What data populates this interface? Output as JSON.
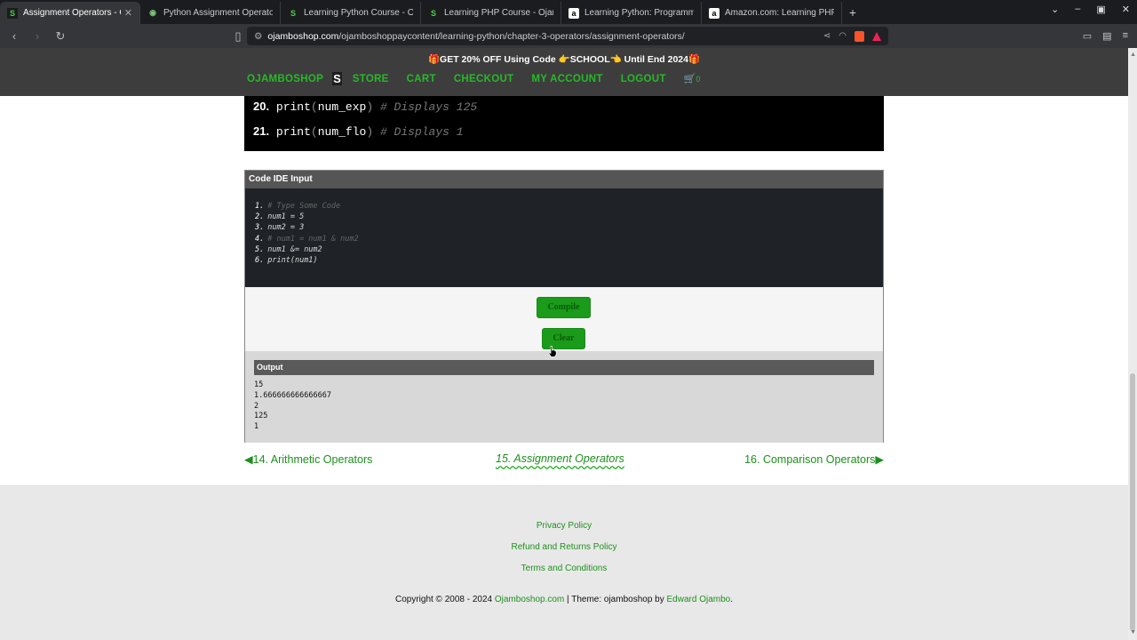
{
  "browser": {
    "tabs": [
      {
        "title": "Assignment Operators - Oj",
        "favicon": "S",
        "active": true
      },
      {
        "title": "Python Assignment Operators",
        "favicon": "P",
        "active": false
      },
      {
        "title": "Learning Python Course - Ojam",
        "favicon": "S",
        "active": false
      },
      {
        "title": "Learning PHP Course - Ojambo",
        "favicon": "S",
        "active": false
      },
      {
        "title": "Learning Python: Programmin",
        "favicon": "a",
        "active": false
      },
      {
        "title": "Amazon.com: Learning PHP: Pr",
        "favicon": "a",
        "active": false
      }
    ],
    "url_host": "ojamboshop.com",
    "url_path": "/ojamboshoppaycontent/learning-python/chapter-3-operators/assignment-operators/"
  },
  "site": {
    "promo": "🎁GET 20% OFF Using Code 👉SCHOOL👈 Until End 2024🎁",
    "brand": "OJAMBOSHOP",
    "brand_logo": "S",
    "menu": [
      "STORE",
      "CART",
      "CHECKOUT",
      "MY ACCOUNT",
      "LOGOUT"
    ],
    "cart_count": "0"
  },
  "code_snippet": [
    {
      "num": "20.",
      "code": "print",
      "arg": "num_exp",
      "comment": "# Displays 125"
    },
    {
      "num": "21.",
      "code": "print",
      "arg": "num_flo",
      "comment": "# Displays 1"
    }
  ],
  "ide": {
    "header": "Code IDE Input",
    "lines": [
      {
        "num": "1.",
        "text": "# Type Some Code",
        "type": "comment"
      },
      {
        "num": "2.",
        "text": "num1 = 5",
        "type": "code"
      },
      {
        "num": "3.",
        "text": "num2 = 3",
        "type": "code"
      },
      {
        "num": "4.",
        "text": "# num1 = num1 & num2",
        "type": "comment"
      },
      {
        "num": "5.",
        "text": "num1 &= num2",
        "type": "code"
      },
      {
        "num": "6.",
        "text": "print(num1)",
        "type": "code"
      }
    ],
    "compile_label": "Compile",
    "clear_label": "Clear",
    "output_header": "Output",
    "output_lines": [
      "15",
      "1.666666666666667",
      "2",
      "125",
      "1"
    ]
  },
  "pager": {
    "prev": "◀14. Arithmetic Operators",
    "current": "15. Assignment Operators",
    "next": "16. Comparison Operators▶"
  },
  "footer": {
    "links": [
      "Privacy Policy",
      "Refund and Returns Policy",
      "Terms and Conditions"
    ],
    "copyright_prefix": "Copyright © 2008 - 2024 ",
    "copyright_site": "Ojamboshop.com",
    "copyright_mid": " | Theme: ojamboshop by ",
    "copyright_author": "Edward Ojambo",
    "copyright_suffix": "."
  }
}
